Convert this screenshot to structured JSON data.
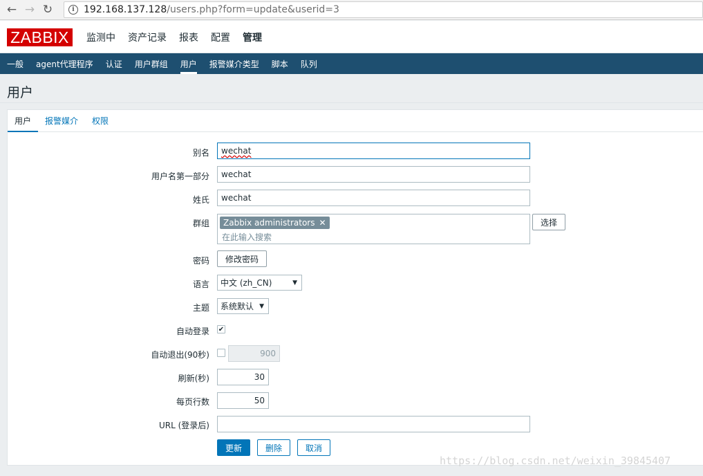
{
  "browser": {
    "url_host": "192.168.137.128",
    "url_path": "/users.php?form=update&userid=3"
  },
  "header": {
    "logo": "ZABBIX",
    "main_menu": [
      "监测中",
      "资产记录",
      "报表",
      "配置",
      "管理"
    ],
    "main_active": "管理",
    "sub_menu": [
      "一般",
      "agent代理程序",
      "认证",
      "用户群组",
      "用户",
      "报警媒介类型",
      "脚本",
      "队列"
    ],
    "sub_active": "用户"
  },
  "page": {
    "title": "用户"
  },
  "tabs": [
    "用户",
    "报警媒介",
    "权限"
  ],
  "form": {
    "alias": {
      "label": "别名",
      "value": "wechat"
    },
    "name": {
      "label": "用户名第一部分",
      "value": "wechat"
    },
    "surname": {
      "label": "姓氏",
      "value": "wechat"
    },
    "groups": {
      "label": "群组",
      "tag": "Zabbix administrators",
      "search_placeholder": "在此输入搜索",
      "select_button": "选择"
    },
    "password": {
      "label": "密码",
      "button": "修改密码"
    },
    "language": {
      "label": "语言",
      "value": "中文 (zh_CN)"
    },
    "theme": {
      "label": "主题",
      "value": "系统默认"
    },
    "autologin": {
      "label": "自动登录",
      "checked": true
    },
    "autologout": {
      "label": "自动退出(90秒)",
      "checked": false,
      "value": "900"
    },
    "refresh": {
      "label": "刷新(秒)",
      "value": "30"
    },
    "rows_per_page": {
      "label": "每页行数",
      "value": "50"
    },
    "url": {
      "label": "URL (登录后)",
      "value": ""
    },
    "buttons": {
      "update": "更新",
      "delete": "删除",
      "cancel": "取消"
    }
  },
  "watermark": "https://blog.csdn.net/weixin_39845407"
}
